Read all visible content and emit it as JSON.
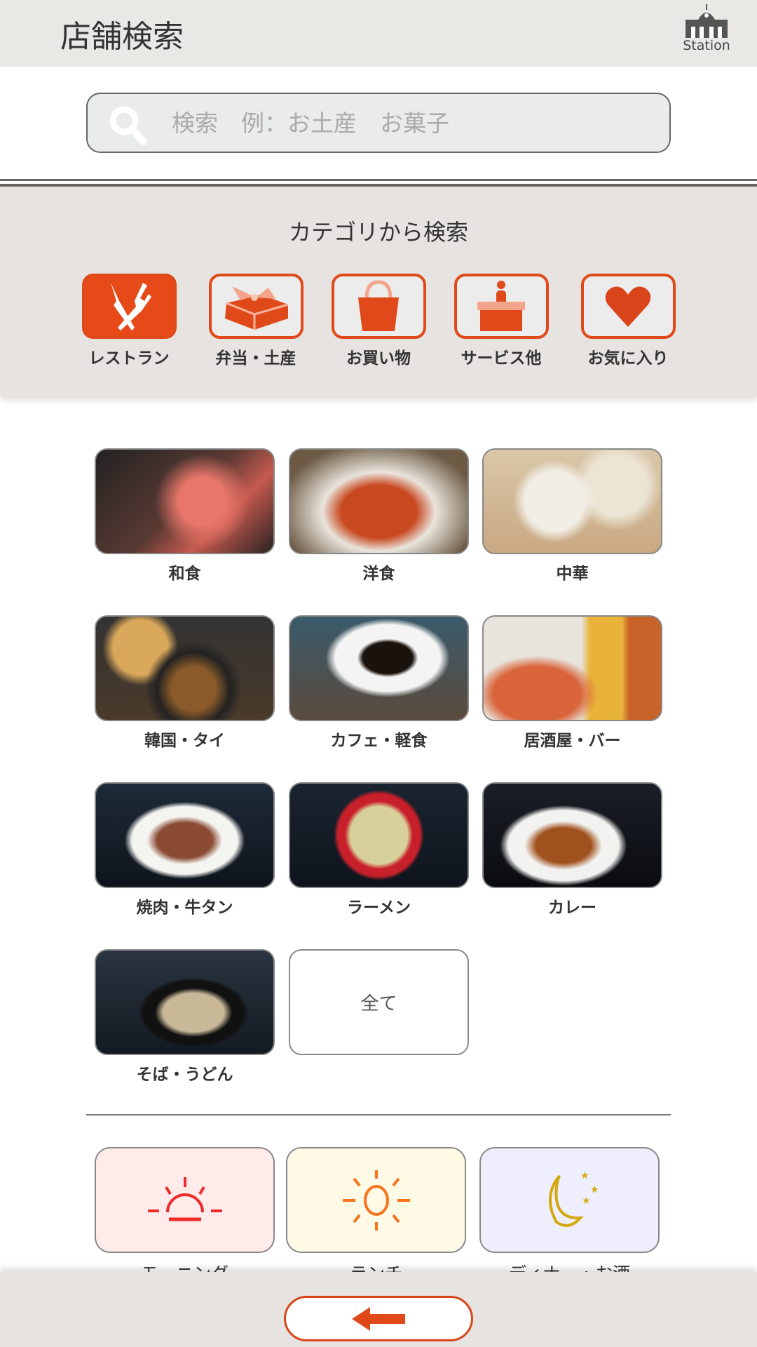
{
  "header": {
    "title": "店舗検索",
    "logo_text": "Station"
  },
  "search": {
    "placeholder": "検索　例：お土産　お菓子"
  },
  "category_section": {
    "heading": "カテゴリから検索",
    "items": [
      {
        "label": "レストラン",
        "icon": "fork-knife-icon",
        "active": true
      },
      {
        "label": "弁当・土産",
        "icon": "gift-box-icon"
      },
      {
        "label": "お買い物",
        "icon": "shopping-bag-icon"
      },
      {
        "label": "サービス他",
        "icon": "service-counter-icon"
      },
      {
        "label": "お気に入り",
        "icon": "heart-icon"
      }
    ]
  },
  "genres": [
    {
      "label": "和食"
    },
    {
      "label": "洋食"
    },
    {
      "label": "中華"
    },
    {
      "label": "韓国・タイ"
    },
    {
      "label": "カフェ・軽食"
    },
    {
      "label": "居酒屋・バー"
    },
    {
      "label": "焼肉・牛タン"
    },
    {
      "label": "ラーメン"
    },
    {
      "label": "カレー"
    },
    {
      "label": "そば・うどん"
    },
    {
      "label": "全て"
    }
  ],
  "times": [
    {
      "label": "モーニング",
      "icon": "sunrise-icon",
      "bg": "#ffecea"
    },
    {
      "label": "ランチ",
      "icon": "sun-icon",
      "bg": "#fffae6"
    },
    {
      "label": "ディナー・お酒",
      "icon": "moon-stars-icon",
      "bg": "#eeeefc"
    }
  ],
  "colors": {
    "accent": "#e64a19",
    "header_bg": "#eae8e5"
  }
}
